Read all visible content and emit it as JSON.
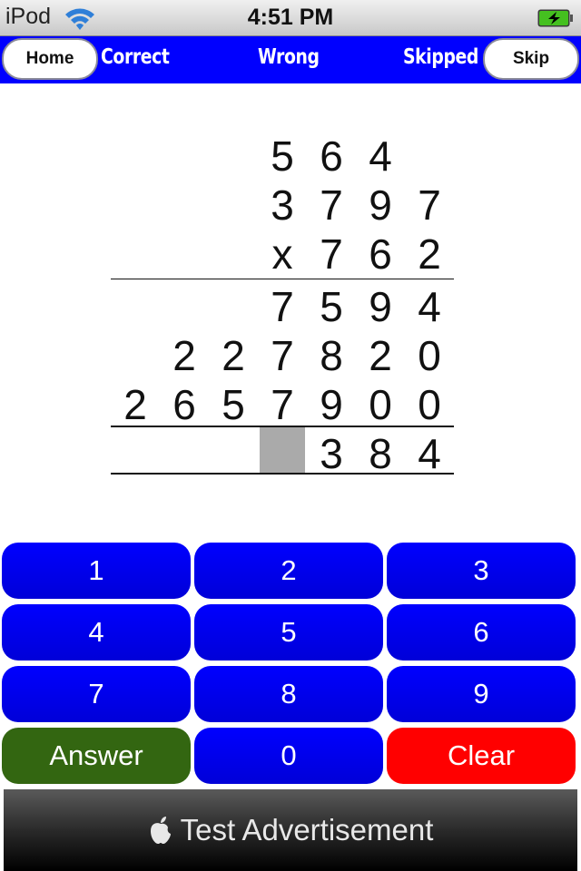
{
  "status_bar": {
    "carrier": "iPod",
    "time": "4:51 PM",
    "wifi_icon": "wifi-icon",
    "battery_icon": "battery-charging-icon"
  },
  "nav": {
    "home_label": "Home",
    "correct_label": "Correct",
    "wrong_label": "Wrong",
    "skipped_label": "Skipped",
    "skip_label": "Skip"
  },
  "problem": {
    "carry_row": [
      "",
      "",
      "",
      "5",
      "6",
      "4",
      ""
    ],
    "multiplicand": [
      "",
      "",
      "",
      "3",
      "7",
      "9",
      "7"
    ],
    "multiplier": [
      "",
      "",
      "",
      "x",
      "7",
      "6",
      "2"
    ],
    "partial_1": [
      "",
      "",
      "",
      "7",
      "5",
      "9",
      "4"
    ],
    "partial_2": [
      "",
      "2",
      "2",
      "7",
      "8",
      "2",
      "0"
    ],
    "partial_3": [
      "2",
      "6",
      "5",
      "7",
      "9",
      "0",
      "0"
    ],
    "answer": [
      "",
      "",
      "",
      "",
      "3",
      "8",
      "4"
    ],
    "active_answer_column": 3
  },
  "keypad": {
    "keys": [
      "1",
      "2",
      "3",
      "4",
      "5",
      "6",
      "7",
      "8",
      "9"
    ],
    "answer_label": "Answer",
    "zero_label": "0",
    "clear_label": "Clear"
  },
  "ad": {
    "icon": "apple-icon",
    "text": "Test Advertisement"
  },
  "colors": {
    "nav_bg": "#0000ff",
    "key_blue": "#0000ff",
    "answer_green": "#336611",
    "clear_red": "#ff0000",
    "active_cell": "#aaaaaa"
  }
}
